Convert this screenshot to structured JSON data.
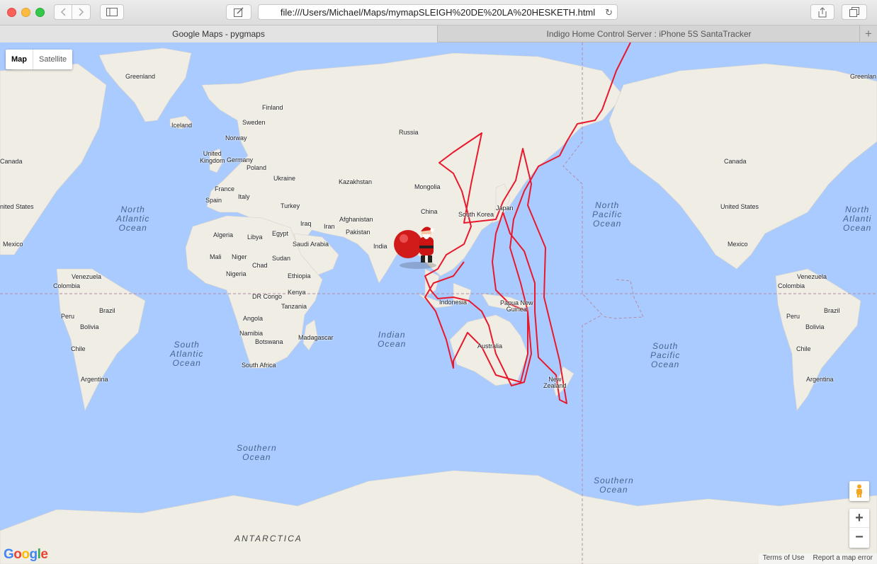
{
  "browser": {
    "url": "file:///Users/Michael/Maps/mymapSLEIGH%20DE%20LA%20HESKETH.html",
    "tabs": [
      {
        "label": "Google Maps - pygmaps",
        "active": true
      },
      {
        "label": "Indigo Home Control Server : iPhone 5S SantaTracker",
        "active": false
      }
    ],
    "new_tab_label": "+",
    "icons": [
      "back-icon",
      "forward-icon",
      "sidebar-icon",
      "compose-icon",
      "reload-icon",
      "share-icon",
      "tabs-overview-icon"
    ]
  },
  "map": {
    "type_control": {
      "map_label": "Map",
      "satellite_label": "Satellite",
      "selected": "Map"
    },
    "zoom_in": "+",
    "zoom_out": "−",
    "logo": "Google",
    "footer": {
      "terms": "Terms of Use",
      "report": "Report a map error"
    },
    "colors": {
      "ocean": "#aacbff",
      "land": "#f2efe9",
      "route": "#e8192c"
    },
    "labels": {
      "greenland": "Greenland",
      "greenland2": "Greenlan",
      "iceland": "Iceland",
      "finland": "Finland",
      "sweden": "Sweden",
      "norway": "Norway",
      "uk": "United\nKingdom",
      "poland": "Poland",
      "germany": "Germany",
      "ukraine": "Ukraine",
      "france": "France",
      "italy": "Italy",
      "spain": "Spain",
      "turkey": "Turkey",
      "russia": "Russia",
      "kazakhstan": "Kazakhstan",
      "mongolia": "Mongolia",
      "china": "China",
      "south_korea": "South Korea",
      "japan": "Japan",
      "afghanistan": "Afghanistan",
      "iraq": "Iraq",
      "iran": "Iran",
      "pakistan": "Pakistan",
      "india": "India",
      "saudi": "Saudi Arabia",
      "egypt": "Egypt",
      "algeria": "Algeria",
      "libya": "Libya",
      "mali": "Mali",
      "niger": "Niger",
      "chad": "Chad",
      "sudan": "Sudan",
      "nigeria": "Nigeria",
      "ethiopia": "Ethiopia",
      "kenya": "Kenya",
      "drc": "DR Congo",
      "tanzania": "Tanzania",
      "angola": "Angola",
      "namibia": "Namibia",
      "botswana": "Botswana",
      "madagascar": "Madagascar",
      "south_africa": "South Africa",
      "indonesia": "Indonesia",
      "png": "Papua New\nGuinea",
      "australia": "Australia",
      "new_zealand": "New\nZealand",
      "canada": "Canada",
      "canada2": "Canada",
      "us": "United States",
      "us2": "United States",
      "mexico": "Mexico",
      "mexico2": "Mexico",
      "venezuela": "Venezuela",
      "venezuela2": "Venezuela",
      "colombia": "Colombia",
      "colombia2": "Colombia",
      "peru": "Peru",
      "peru2": "Peru",
      "brazil": "Brazil",
      "brazil2": "Brazil",
      "bolivia": "Bolivia",
      "bolivia2": "Bolivia",
      "chile": "Chile",
      "chile2": "Chile",
      "argentina": "Argentina",
      "argentina2": "Argentina",
      "canada_left": "Canada",
      "us_left": "nited States"
    },
    "oceans": {
      "north_atlantic": "North\nAtlantic\nOcean",
      "south_atlantic": "South\nAtlantic\nOcean",
      "indian": "Indian\nOcean",
      "north_pacific": "North\nPacific\nOcean",
      "south_pacific": "South\nPacific\nOcean",
      "southern_1": "Southern\nOcean",
      "southern_2": "Southern\nOcean",
      "north_atlantic_2": "North\nAtlanti\nOcean"
    },
    "antarctica": "ANTARCTICA",
    "marker": "santa-sleigh-marker"
  }
}
